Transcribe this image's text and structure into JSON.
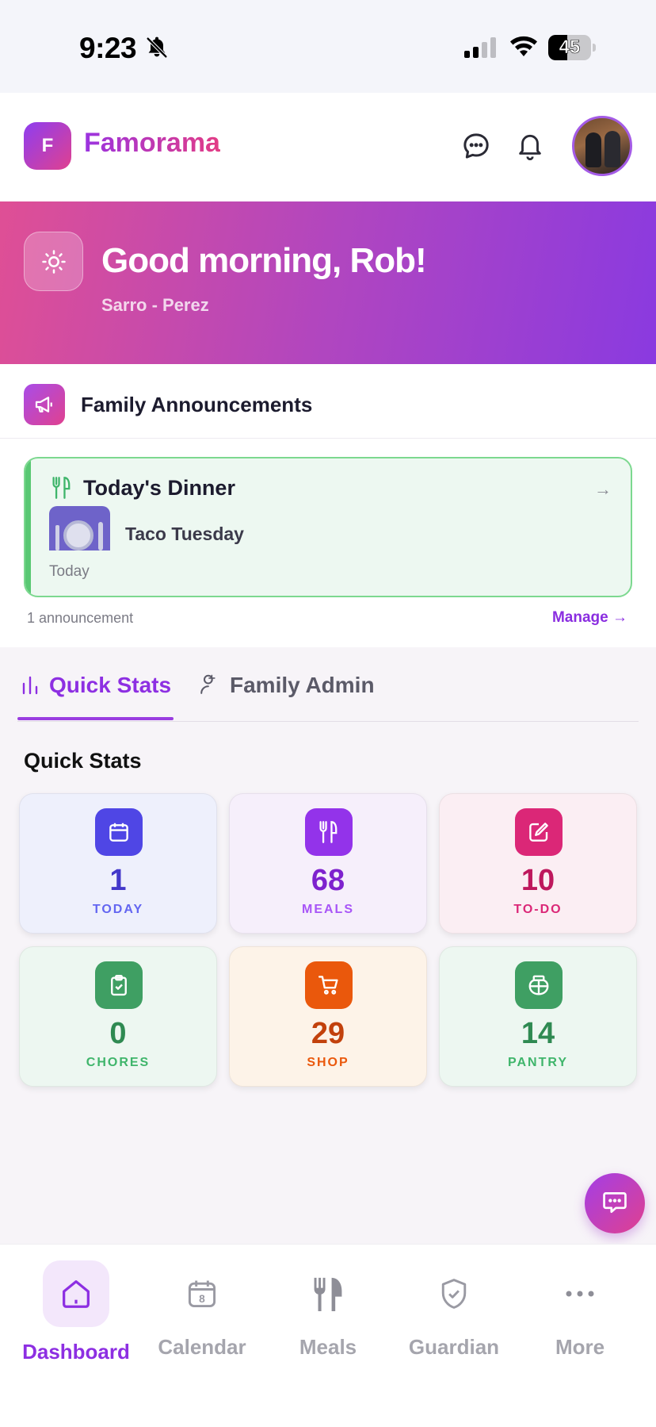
{
  "status_bar": {
    "time": "9:23",
    "battery": "45",
    "battery_level": 0.45
  },
  "header": {
    "logo_letter": "F",
    "app_name": "Famorama"
  },
  "hero": {
    "greeting": "Good morning, Rob!",
    "family": "Sarro - Perez"
  },
  "announcements": {
    "title": "Family Announcements",
    "card": {
      "title": "Today's Dinner",
      "meal": "Taco Tuesday",
      "date": "Today"
    },
    "count": "1 announcement",
    "manage": "Manage →"
  },
  "tabs": [
    {
      "label": "Quick Stats",
      "active": true
    },
    {
      "label": "Family Admin",
      "active": false
    }
  ],
  "stats_section_title": "Quick Stats",
  "stats": [
    {
      "value": "1",
      "label": "TODAY",
      "icon": "calendar-icon",
      "icon_bg": "#4f46e5",
      "value_color": "#4338ca",
      "label_color": "#6366f1",
      "card_bg": "#eef0fc"
    },
    {
      "value": "68",
      "label": "MEALS",
      "icon": "utensils-icon",
      "icon_bg": "#9333ea",
      "value_color": "#7e22ce",
      "label_color": "#a855f7",
      "card_bg": "#f6effb"
    },
    {
      "value": "10",
      "label": "TO-DO",
      "icon": "edit-icon",
      "icon_bg": "#db2777",
      "value_color": "#be185d",
      "label_color": "#db2777",
      "card_bg": "#fbeef3"
    },
    {
      "value": "0",
      "label": "CHORES",
      "icon": "clipboard-check-icon",
      "icon_bg": "#3f9f63",
      "value_color": "#2f8a52",
      "label_color": "#3fb56b",
      "card_bg": "#edf7f1"
    },
    {
      "value": "29",
      "label": "SHOP",
      "icon": "cart-icon",
      "icon_bg": "#ea580c",
      "value_color": "#c2410c",
      "label_color": "#ea580c",
      "card_bg": "#fdf3e8"
    },
    {
      "value": "14",
      "label": "PANTRY",
      "icon": "jar-icon",
      "icon_bg": "#3f9f63",
      "value_color": "#2f8a52",
      "label_color": "#3fb56b",
      "card_bg": "#edf7f1"
    }
  ],
  "bottom_nav": [
    {
      "label": "Dashboard",
      "icon": "home-icon",
      "active": true
    },
    {
      "label": "Calendar",
      "icon": "calendar-day-icon",
      "active": false,
      "badge": "8"
    },
    {
      "label": "Meals",
      "icon": "utensils-icon",
      "active": false
    },
    {
      "label": "Guardian",
      "icon": "shield-check-icon",
      "active": false
    },
    {
      "label": "More",
      "icon": "more-icon",
      "active": false
    }
  ]
}
